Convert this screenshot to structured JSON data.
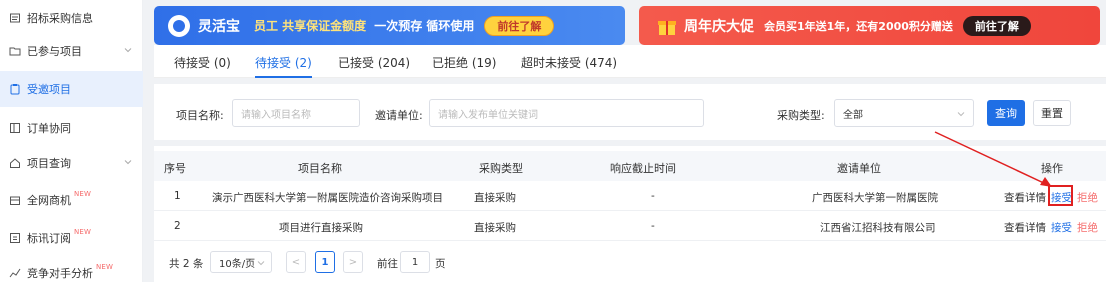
{
  "sidebar": {
    "items": [
      {
        "label": "招标采购信息",
        "icon": "document-icon",
        "new": ""
      },
      {
        "label": "已参与项目",
        "icon": "folder-icon",
        "new": ""
      },
      {
        "label": "受邀项目",
        "icon": "clipboard-icon",
        "new": ""
      },
      {
        "label": "订单协同",
        "icon": "list-icon",
        "new": ""
      },
      {
        "label": "项目查询",
        "icon": "home-icon",
        "new": ""
      },
      {
        "label": "全网商机",
        "icon": "shop-icon",
        "new": "NEW"
      },
      {
        "label": "标讯订阅",
        "icon": "subscribe-icon",
        "new": "NEW"
      },
      {
        "label": "竞争对手分析",
        "icon": "chart-icon",
        "new": "NEW"
      }
    ]
  },
  "banner_left": {
    "title": "灵活宝",
    "text1": "员工 共享保证金额度",
    "text2": "一次预存 循环使用",
    "button": "前往了解"
  },
  "banner_right": {
    "title": "周年庆大促",
    "text": "会员买1年送1年，还有2000积分赠送",
    "button": "前往了解"
  },
  "tabs": [
    {
      "label": "待接受 (0)"
    },
    {
      "label": "待接受 (2)"
    },
    {
      "label": "已接受 (204)"
    },
    {
      "label": "已拒绝 (19)"
    },
    {
      "label": "超时未接受 (474)"
    }
  ],
  "filter": {
    "project_name_label": "项目名称:",
    "project_name_placeholder": "请输入项目名称",
    "inviter_label": "邀请单位:",
    "inviter_placeholder": "请输入发布单位关键词",
    "purchase_type_label": "采购类型:",
    "purchase_type_value": "全部",
    "search_button": "查询",
    "reset_button": "重置"
  },
  "table": {
    "headers": [
      "序号",
      "项目名称",
      "采购类型",
      "响应截止时间",
      "邀请单位",
      "操作"
    ],
    "rows": [
      {
        "index": "1",
        "name": "演示广西医科大学第一附属医院造价咨询采购项目",
        "type": "直接采购",
        "deadline": "-",
        "inviter": "广西医科大学第一附属医院",
        "view": "查看详情",
        "accept": "接受",
        "reject": "拒绝"
      },
      {
        "index": "2",
        "name": "项目进行直接采购",
        "type": "直接采购",
        "deadline": "-",
        "inviter": "江西省江招科技有限公司",
        "view": "查看详情",
        "accept": "接受",
        "reject": "拒绝"
      }
    ]
  },
  "pager": {
    "total": "共 2 条",
    "page_size": "10条/页",
    "prev": "<",
    "current": "1",
    "next": ">",
    "goto_label": "前往",
    "goto_value": "1",
    "page_unit": "页"
  },
  "colors": {
    "accent": "#1f6fe5",
    "danger": "#f56c6c",
    "highlight_box": "#e02020"
  }
}
